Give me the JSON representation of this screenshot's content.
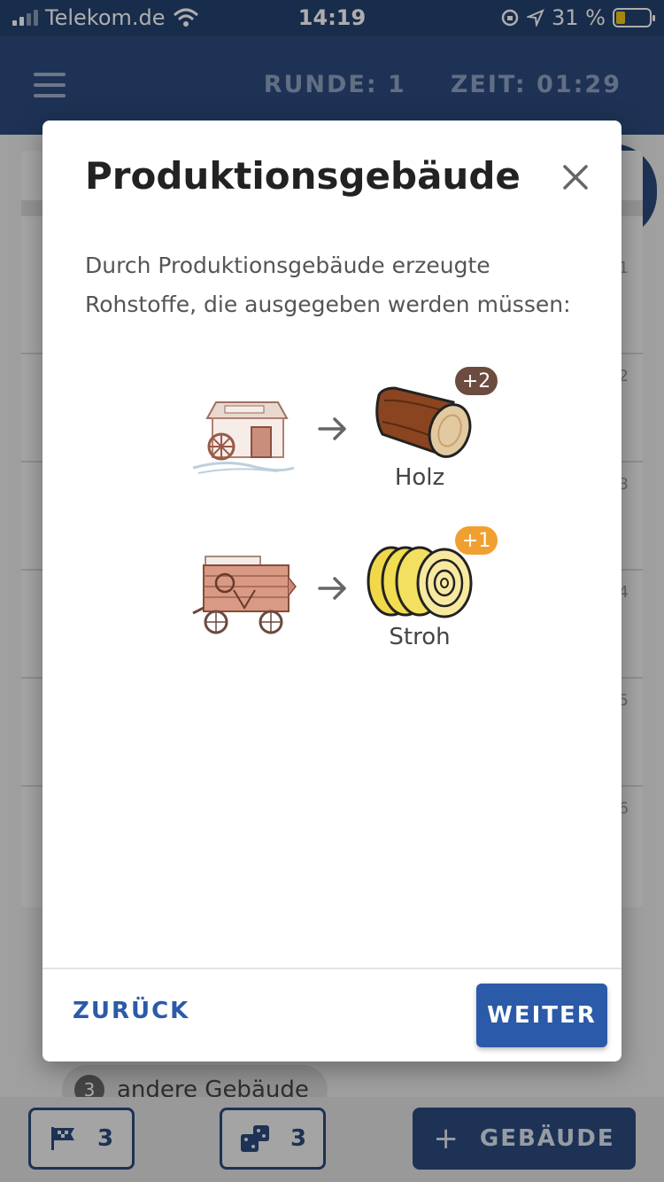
{
  "status_bar": {
    "carrier": "Telekom.de",
    "time": "14:19",
    "battery": "31 %"
  },
  "header": {
    "round_label": "RUNDE: 1",
    "time_label": "ZEIT: 01:29",
    "menu_icon": "hamburger-menu-icon"
  },
  "background": {
    "row_numbers": [
      "1",
      "2",
      "3",
      "4",
      "5",
      "6"
    ],
    "chip": {
      "count": "3",
      "label": "andere Gebäude"
    },
    "bottom": {
      "flag_count": "3",
      "dice_count": "3",
      "add_label": "GEBÄUDE",
      "add_symbol": "+"
    }
  },
  "dialog": {
    "title": "Produktionsgebäude",
    "description": "Durch Produktionsgebäude erzeugte Rohstoffe, die ausgegeben werden müssen:",
    "productions": [
      {
        "building_icon": "sawmill-icon",
        "resource_icon": "log-icon",
        "resource": "Holz",
        "amount": "+2",
        "badge_color": "#6b4c3f"
      },
      {
        "building_icon": "thresher-wagon-icon",
        "resource_icon": "straw-bale-icon",
        "resource": "Stroh",
        "amount": "+1",
        "badge_color": "#f0a030"
      }
    ],
    "back_label": "ZURÜCK",
    "next_label": "WEITER"
  }
}
